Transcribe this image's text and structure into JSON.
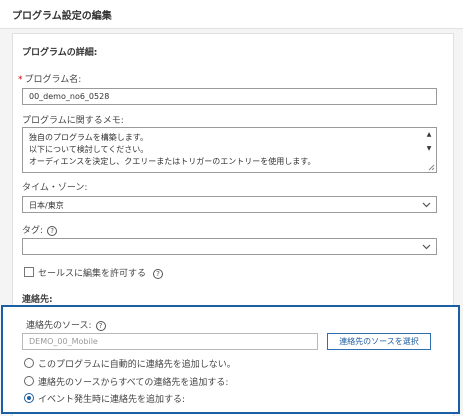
{
  "header": {
    "title": "プログラム設定の編集"
  },
  "details": {
    "section_title": "プログラムの詳細:",
    "name_label": "プログラム名:",
    "name_required_mark": "*",
    "name_value": "00_demo_no6_0528",
    "memo_label": "プログラムに関するメモ:",
    "memo_lines": [
      "独自のプログラムを構築します。",
      "以下について検討してください。",
      "オーディエンスを決定し、クエリーまたはトリガーのエントリーを使用します。"
    ],
    "timezone_label": "タイム・ゾーン:",
    "timezone_value": "日本/東京",
    "tags_label": "タグ:",
    "tags_value": "",
    "sales_edit_label": "セールスに編集を許可する",
    "help_glyph": "?"
  },
  "contacts": {
    "section_title": "連絡先:",
    "source_label": "連絡先のソース:",
    "source_value": "DEMO_00_Mobile",
    "select_source_button": "連絡先のソースを選択",
    "radio_options": [
      {
        "label": "このプログラムに自動的に連絡先を追加しない。",
        "selected": false
      },
      {
        "label": "連絡先のソースからすべての連絡先を追加する:",
        "selected": false
      },
      {
        "label": "イベント発生時に連絡先を追加する:",
        "selected": true
      }
    ]
  },
  "colors": {
    "highlight_border": "#1a5fa3",
    "accent": "#1f5ea3"
  },
  "icons": {
    "help": "help-icon",
    "chevron": "chevron-down-icon",
    "scroll_up": "scroll-up-icon",
    "scroll_down": "scroll-down-icon"
  }
}
